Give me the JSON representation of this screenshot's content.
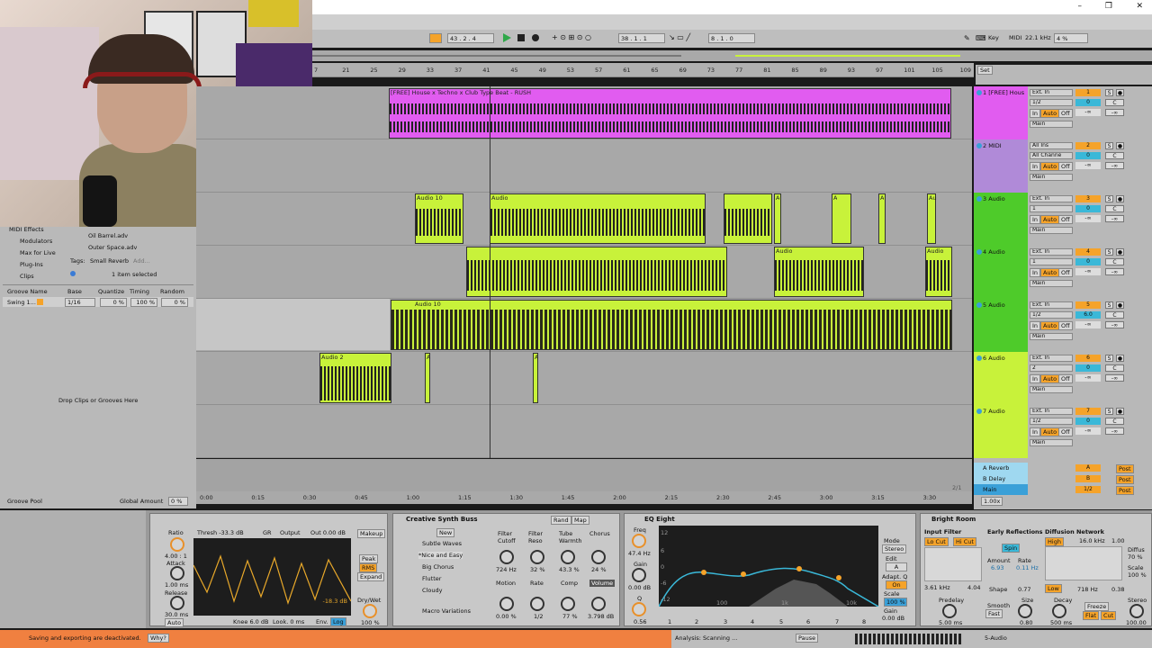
{
  "colors": {
    "accent": "#f5a32a",
    "purple": "#e15cf0",
    "green": "#7ed321",
    "lime": "#c8f23a"
  },
  "transport": {
    "tempo_pos": "43 . 2 . 4",
    "song_pos": "38 . 1 . 1",
    "loop_len": "8 . 1 . 0",
    "key": "Key",
    "midi": "MIDI",
    "sample_rate": "22.1 kHz",
    "cpu": "4 %"
  },
  "ruler": [
    "7",
    "21",
    "25",
    "29",
    "33",
    "37",
    "41",
    "45",
    "49",
    "53",
    "57",
    "61",
    "65",
    "69",
    "73",
    "77",
    "81",
    "85",
    "89",
    "93",
    "97",
    "101",
    "105",
    "109"
  ],
  "time_ruler": [
    "0:00",
    "0:15",
    "0:30",
    "0:45",
    "1:00",
    "1:15",
    "1:30",
    "1:45",
    "2:00",
    "2:15",
    "2:30",
    "2:45",
    "3:00",
    "3:15",
    "3:30"
  ],
  "browser": {
    "places": [
      "MIDI Effects",
      "Modulators",
      "Max for Live",
      "Plug-Ins",
      "Clips"
    ],
    "files": [
      "Oil Barrel.adv",
      "Outer Space.adv"
    ],
    "tags_label": "Tags:",
    "tag": "Small Reverb",
    "tag_add": "Add...",
    "selection": "1 item selected",
    "groove_headers": [
      "Groove Name",
      "Base",
      "Quantize",
      "Timing",
      "Random"
    ],
    "groove_row": [
      "Swing 1...",
      "1/16",
      "0 %",
      "100 %",
      "0 %"
    ],
    "drop_hint": "Drop Clips or Grooves Here",
    "groove_pool": "Groove Pool",
    "global_amount": "Global Amount",
    "global_value": "0 %"
  },
  "clips": {
    "main": "[FREE] House x Techno x Club Type Beat - RUSH",
    "a10": "Audio 10",
    "a2": "Audio 2",
    "a": "A",
    "audio": "Audio",
    "au": "Au"
  },
  "mixer": {
    "set": "Set",
    "tracks": [
      {
        "name": "1 [FREE] Hous",
        "input": "Ext. In",
        "ch": "1/2",
        "num": "1",
        "vol": "0",
        "pan": "C",
        "out": "Main"
      },
      {
        "name": "2 MIDI",
        "input": "All Ins",
        "ch": "All Channe",
        "num": "2",
        "vol": "0",
        "pan": "C",
        "out": "Main"
      },
      {
        "name": "3 Audio",
        "input": "Ext. In",
        "ch": "1",
        "num": "3",
        "vol": "0",
        "pan": "C",
        "out": "Main"
      },
      {
        "name": "4 Audio",
        "input": "Ext. In",
        "ch": "1",
        "num": "4",
        "vol": "0",
        "pan": "C",
        "out": "Main"
      },
      {
        "name": "5 Audio",
        "input": "Ext. In",
        "ch": "1/2",
        "num": "5",
        "vol": "6.0",
        "pan": "C",
        "out": "Main"
      },
      {
        "name": "6 Audio",
        "input": "Ext. In",
        "ch": "2",
        "num": "6",
        "vol": "0",
        "pan": "C",
        "out": "Main"
      },
      {
        "name": "7 Audio",
        "input": "Ext. In",
        "ch": "1/2",
        "num": "7",
        "vol": "0",
        "pan": "C",
        "out": "Main"
      }
    ],
    "monitor": [
      "In",
      "Auto",
      "Off"
    ],
    "returns": [
      {
        "name": "A Reverb",
        "num": "A"
      },
      {
        "name": "B Delay",
        "num": "B"
      },
      {
        "name": "Main",
        "num": "1/2"
      }
    ],
    "inf": "-∞",
    "post": "Post",
    "ratio": "2/1",
    "zoom": "1.00x"
  },
  "devices": {
    "comp": {
      "thresh": "Thresh -33.3 dB",
      "gr": "GR",
      "output": "Output",
      "out": "Out 0.00 dB",
      "ratio_l": "Ratio",
      "ratio": "4.00 : 1",
      "attack_l": "Attack",
      "attack": "1.00 ms",
      "release_l": "Release",
      "release": "30.0 ms",
      "auto": "Auto",
      "makeup": "Makeup",
      "peak": "Peak",
      "rms": "RMS",
      "expand": "Expand",
      "drywet": "Dry/Wet",
      "drywet_v": "100 %",
      "knee": "Knee 6.0 dB",
      "look": "Look. 0 ms",
      "env": "Env.",
      "log": "Log",
      "meter": "-18.3 dB"
    },
    "rack": {
      "title": "Creative Synth Buss",
      "rand": "Rand",
      "map": "Map",
      "new": "New",
      "presets": [
        "Subtle Waves",
        "*Nice and Easy",
        "Big Chorus",
        "Flutter",
        "Cloudy"
      ],
      "macro_variations": "Macro Variations",
      "macros": [
        {
          "l": "Filter Cutoff",
          "v": "724 Hz"
        },
        {
          "l": "Filter Reso",
          "v": "32 %"
        },
        {
          "l": "Tube Warmth",
          "v": "43.3 %"
        },
        {
          "l": "Chorus",
          "v": "24 %"
        },
        {
          "l": "Motion",
          "v": "0.00 %"
        },
        {
          "l": "Rate",
          "v": "1/2"
        },
        {
          "l": "Comp",
          "v": "77 %"
        },
        {
          "l": "Volume",
          "v": "3.798 dB"
        }
      ]
    },
    "eq": {
      "title": "EQ Eight",
      "freq": "Freq",
      "freq_v": "47.4 Hz",
      "gain": "Gain",
      "gain_v": "0.00 dB",
      "q": "Q",
      "q_v": "0.56",
      "mode": "Mode",
      "mode_v": "Stereo",
      "edit": "Edit",
      "edit_v": "A",
      "adapt": "Adapt. Q",
      "on": "On",
      "scale": "Scale",
      "scale_v": "100 %",
      "gain2": "Gain",
      "gain2_v": "0.00 dB",
      "db": [
        "12",
        "6",
        "0",
        "-6",
        "-12"
      ],
      "hz": [
        "100",
        "1k",
        "10k"
      ],
      "bands": [
        "1",
        "2",
        "3",
        "4",
        "5",
        "6",
        "7",
        "8"
      ]
    },
    "reverb": {
      "title": "Bright Room",
      "input_filter": "Input Filter",
      "locut": "Lo Cut",
      "hicut": "Hi Cut",
      "f1": "3.61 kHz",
      "f2": "4.04",
      "predelay": "Predelay",
      "predelay_v": "5.00 ms",
      "early": "Early Reflections",
      "spin": "Spin",
      "amount": "Amount",
      "amount_v": "6.93",
      "rate": "Rate",
      "rate_v": "0.11 Hz",
      "shape": "Shape",
      "shape_v": "0.77",
      "smooth": "Smooth",
      "smooth_v": "Fast",
      "size": "Size",
      "size_v": "0.80",
      "diffusion": "Diffusion Network",
      "high": "High",
      "high_v": "16.0 kHz",
      "high_n": "1.00",
      "low": "Low",
      "low_f": "718 Hz",
      "low_n": "0.38",
      "diffu": "Diffus",
      "diffu_v": "70 %",
      "scale": "Scale",
      "scale_v": "100 %",
      "decay": "Decay",
      "decay_v": "500 ms",
      "freeze": "Freeze",
      "flat": "Flat",
      "cut": "Cut",
      "stereo": "Stereo",
      "stereo_v": "100.00"
    }
  },
  "status": {
    "warning": "Saving and exporting are deactivated.",
    "why": "Why?",
    "analysis": "Analysis: Scanning ...",
    "pause": "Pause",
    "track": "5-Audio"
  }
}
